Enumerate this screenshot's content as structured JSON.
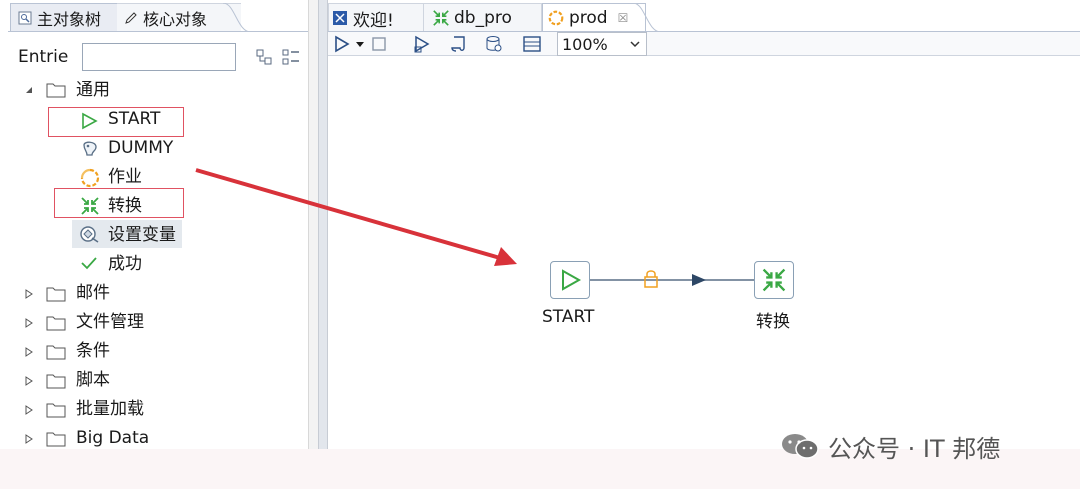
{
  "left_panel": {
    "tabs": [
      {
        "label": "主对象树",
        "icon": "object-tree-icon"
      },
      {
        "label": "核心对象",
        "icon": "pencil-icon"
      }
    ],
    "entries_label": "Entrie:",
    "entries_value": "",
    "tree": [
      {
        "label": "通用",
        "expanded": true,
        "children": [
          {
            "label": "START",
            "icon": "start-triangle-icon",
            "highlighted_box": true
          },
          {
            "label": "DUMMY",
            "icon": "dummy-icon"
          },
          {
            "label": "作业",
            "icon": "job-icon"
          },
          {
            "label": "转换",
            "icon": "transform-icon",
            "highlighted_box": true
          },
          {
            "label": "设置变量",
            "icon": "set-variable-icon",
            "selected": true
          },
          {
            "label": "成功",
            "icon": "success-check-icon"
          }
        ]
      },
      {
        "label": "邮件",
        "expanded": false
      },
      {
        "label": "文件管理",
        "expanded": false
      },
      {
        "label": "条件",
        "expanded": false
      },
      {
        "label": "脚本",
        "expanded": false
      },
      {
        "label": "批量加载",
        "expanded": false
      },
      {
        "label": "Big Data",
        "expanded": false
      }
    ]
  },
  "editor": {
    "tabs": [
      {
        "label": "欢迎!",
        "icon": "welcome-icon"
      },
      {
        "label": "db_pro",
        "icon": "transform-icon"
      },
      {
        "label": "prod",
        "icon": "job-icon",
        "active": true,
        "close": "☒"
      }
    ],
    "zoom": "100%",
    "nodes": [
      {
        "label": "START",
        "icon": "start-triangle-icon"
      },
      {
        "label": "转换",
        "icon": "transform-icon"
      }
    ]
  },
  "colors": {
    "highlight_box": "#e05262",
    "arrow": "#d8323a",
    "hop_line": "#5a6f86",
    "hop_lock": "#f0a020",
    "start_green": "#3aa844"
  },
  "watermark": "公众号 · IT 邦德"
}
